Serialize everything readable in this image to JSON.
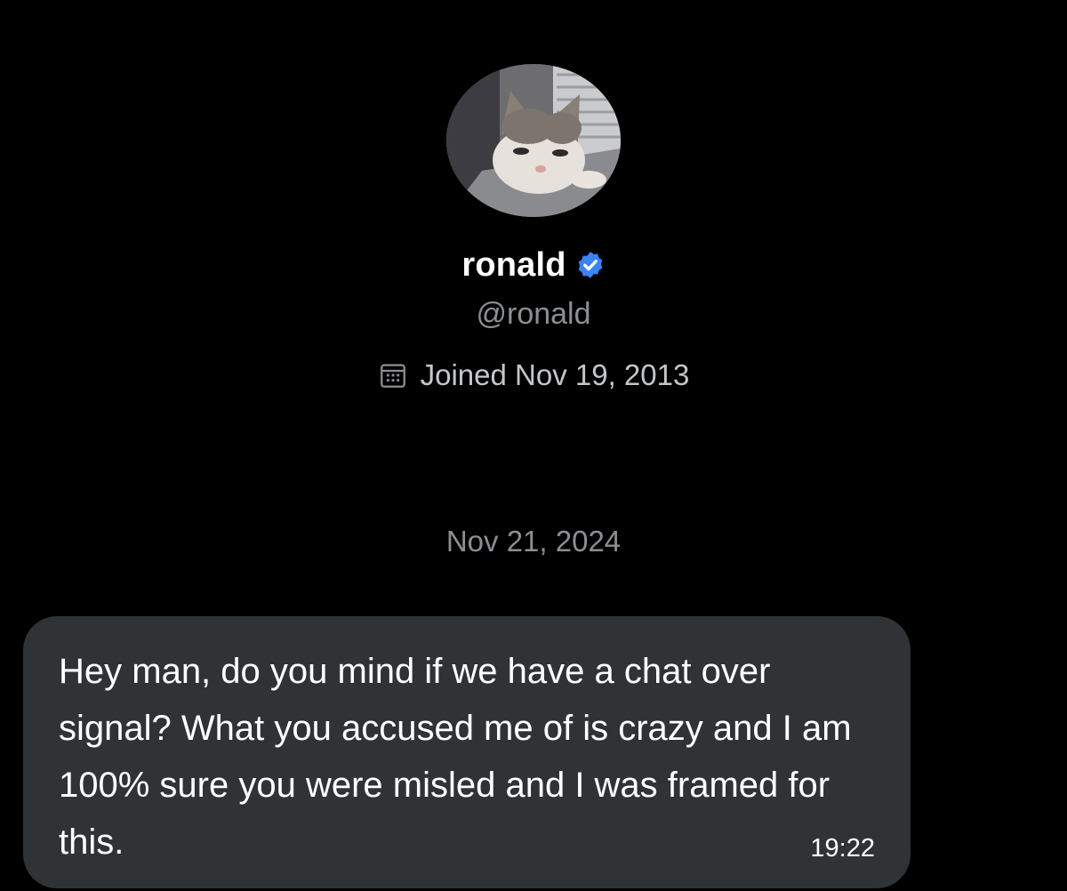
{
  "profile": {
    "avatar_icon": "cat-photo-avatar",
    "display_name": "ronald",
    "verified_icon": "verified-badge-icon",
    "verified_color": "#3b82f6",
    "handle": "@ronald",
    "joined_icon": "calendar-icon",
    "joined_text": "Joined Nov 19, 2013"
  },
  "conversation": {
    "date_divider": "Nov 21, 2024",
    "messages": [
      {
        "text": "Hey man, do you mind if we have a chat over signal? What you accused me of is crazy and I am 100% sure you were misled and I was framed for this.",
        "time": "19:22"
      }
    ]
  },
  "colors": {
    "background": "#000000",
    "bubble": "#2f3336",
    "secondary_text": "#8b8f94"
  }
}
